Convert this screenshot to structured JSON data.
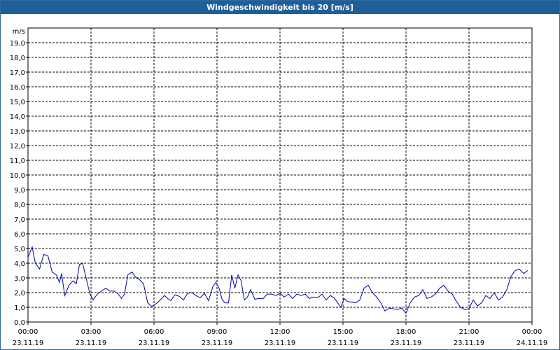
{
  "window": {
    "title": "Windgeschwindigkeit bis 20 [m/s]"
  },
  "colors": {
    "titlebar": "#1f5f98",
    "line": "#0000aa",
    "grid": "#000000"
  },
  "chart_data": {
    "type": "line",
    "title": "Windgeschwindigkeit bis 20 [m/s]",
    "ylabel": "m/s",
    "ylim": [
      0,
      20
    ],
    "ytick_labels": [
      "0,0",
      "1,0",
      "2,0",
      "3,0",
      "4,0",
      "5,0",
      "6,0",
      "7,0",
      "8,0",
      "9,0",
      "10,0",
      "11,0",
      "12,0",
      "13,0",
      "14,0",
      "15,0",
      "16,0",
      "17,0",
      "18,0",
      "19,0"
    ],
    "xlim_hours": [
      0,
      24
    ],
    "xticks": [
      {
        "time": "00:00",
        "date": "23.11.19"
      },
      {
        "time": "03:00",
        "date": "23.11.19"
      },
      {
        "time": "06:00",
        "date": "23.11.19"
      },
      {
        "time": "09:00",
        "date": "23.11.19"
      },
      {
        "time": "12:00",
        "date": "23.11.19"
      },
      {
        "time": "15:00",
        "date": "23.11.19"
      },
      {
        "time": "18:00",
        "date": "23.11.19"
      },
      {
        "time": "21:00",
        "date": "23.11.19"
      },
      {
        "time": "00:00",
        "date": "24.11.19"
      }
    ],
    "grid": true,
    "series": [
      {
        "x": [
          0.0,
          0.2,
          0.35,
          0.55,
          0.75,
          0.95,
          1.15,
          1.35,
          1.5,
          1.6,
          1.75,
          1.95,
          2.15,
          2.3,
          2.45,
          2.6,
          2.8,
          2.95,
          3.1,
          3.3,
          3.5,
          3.7,
          3.9,
          4.1,
          4.3,
          4.45,
          4.6,
          4.75,
          4.95,
          5.15,
          5.3,
          5.5,
          5.7,
          5.9,
          6.1,
          6.3,
          6.5,
          6.65,
          6.8,
          7.0,
          7.2,
          7.4,
          7.6,
          7.8,
          8.0,
          8.2,
          8.4,
          8.6,
          8.8,
          8.95,
          9.1,
          9.25,
          9.4,
          9.55,
          9.7,
          9.85,
          10.0,
          10.15,
          10.3,
          10.45,
          10.6,
          10.8,
          11.0,
          11.2,
          11.4,
          11.6,
          11.8,
          12.0,
          12.2,
          12.4,
          12.6,
          12.8,
          13.0,
          13.2,
          13.4,
          13.6,
          13.8,
          14.0,
          14.2,
          14.4,
          14.6,
          14.75,
          14.9,
          15.05,
          15.2,
          15.4,
          15.6,
          15.8,
          16.0,
          16.2,
          16.4,
          16.6,
          16.8,
          17.0,
          17.2,
          17.4,
          17.6,
          17.8,
          18.0,
          18.2,
          18.4,
          18.6,
          18.8,
          19.0,
          19.2,
          19.4,
          19.6,
          19.8,
          20.0,
          20.2,
          20.4,
          20.6,
          20.8,
          21.0,
          21.2,
          21.4,
          21.6,
          21.8,
          22.0,
          22.2,
          22.4,
          22.6,
          22.8,
          23.0,
          23.2,
          23.4,
          23.6,
          23.8
        ],
        "values": [
          4.4,
          5.1,
          4.0,
          3.6,
          4.6,
          4.5,
          3.4,
          3.2,
          2.7,
          3.3,
          1.8,
          2.5,
          2.8,
          2.6,
          3.9,
          4.0,
          2.8,
          1.9,
          1.5,
          1.9,
          2.1,
          2.3,
          2.1,
          2.1,
          1.9,
          1.6,
          1.9,
          3.2,
          3.4,
          3.0,
          2.9,
          2.6,
          1.3,
          1.05,
          1.25,
          1.5,
          1.8,
          1.6,
          1.45,
          1.85,
          1.75,
          1.5,
          1.95,
          2.0,
          1.8,
          1.65,
          1.95,
          1.45,
          2.4,
          2.7,
          2.3,
          1.5,
          1.3,
          1.3,
          3.2,
          2.3,
          3.2,
          2.8,
          1.5,
          1.7,
          2.2,
          1.55,
          1.6,
          1.6,
          1.9,
          1.9,
          1.8,
          1.95,
          1.7,
          1.9,
          1.6,
          1.9,
          1.8,
          1.9,
          1.6,
          1.7,
          1.65,
          1.9,
          1.5,
          1.8,
          1.6,
          1.3,
          1.0,
          1.6,
          1.4,
          1.35,
          1.3,
          1.5,
          2.3,
          2.5,
          2.0,
          1.7,
          1.3,
          0.75,
          0.95,
          0.9,
          0.85,
          0.95,
          0.6,
          1.3,
          1.7,
          1.8,
          2.2,
          1.6,
          1.7,
          1.9,
          2.3,
          2.5,
          2.1,
          1.9,
          1.4,
          1.0,
          0.85,
          0.9,
          1.5,
          1.1,
          1.3,
          1.8,
          1.6,
          2.0,
          1.5,
          1.7,
          2.2,
          3.1,
          3.5,
          3.6,
          3.3,
          3.5
        ]
      }
    ]
  }
}
